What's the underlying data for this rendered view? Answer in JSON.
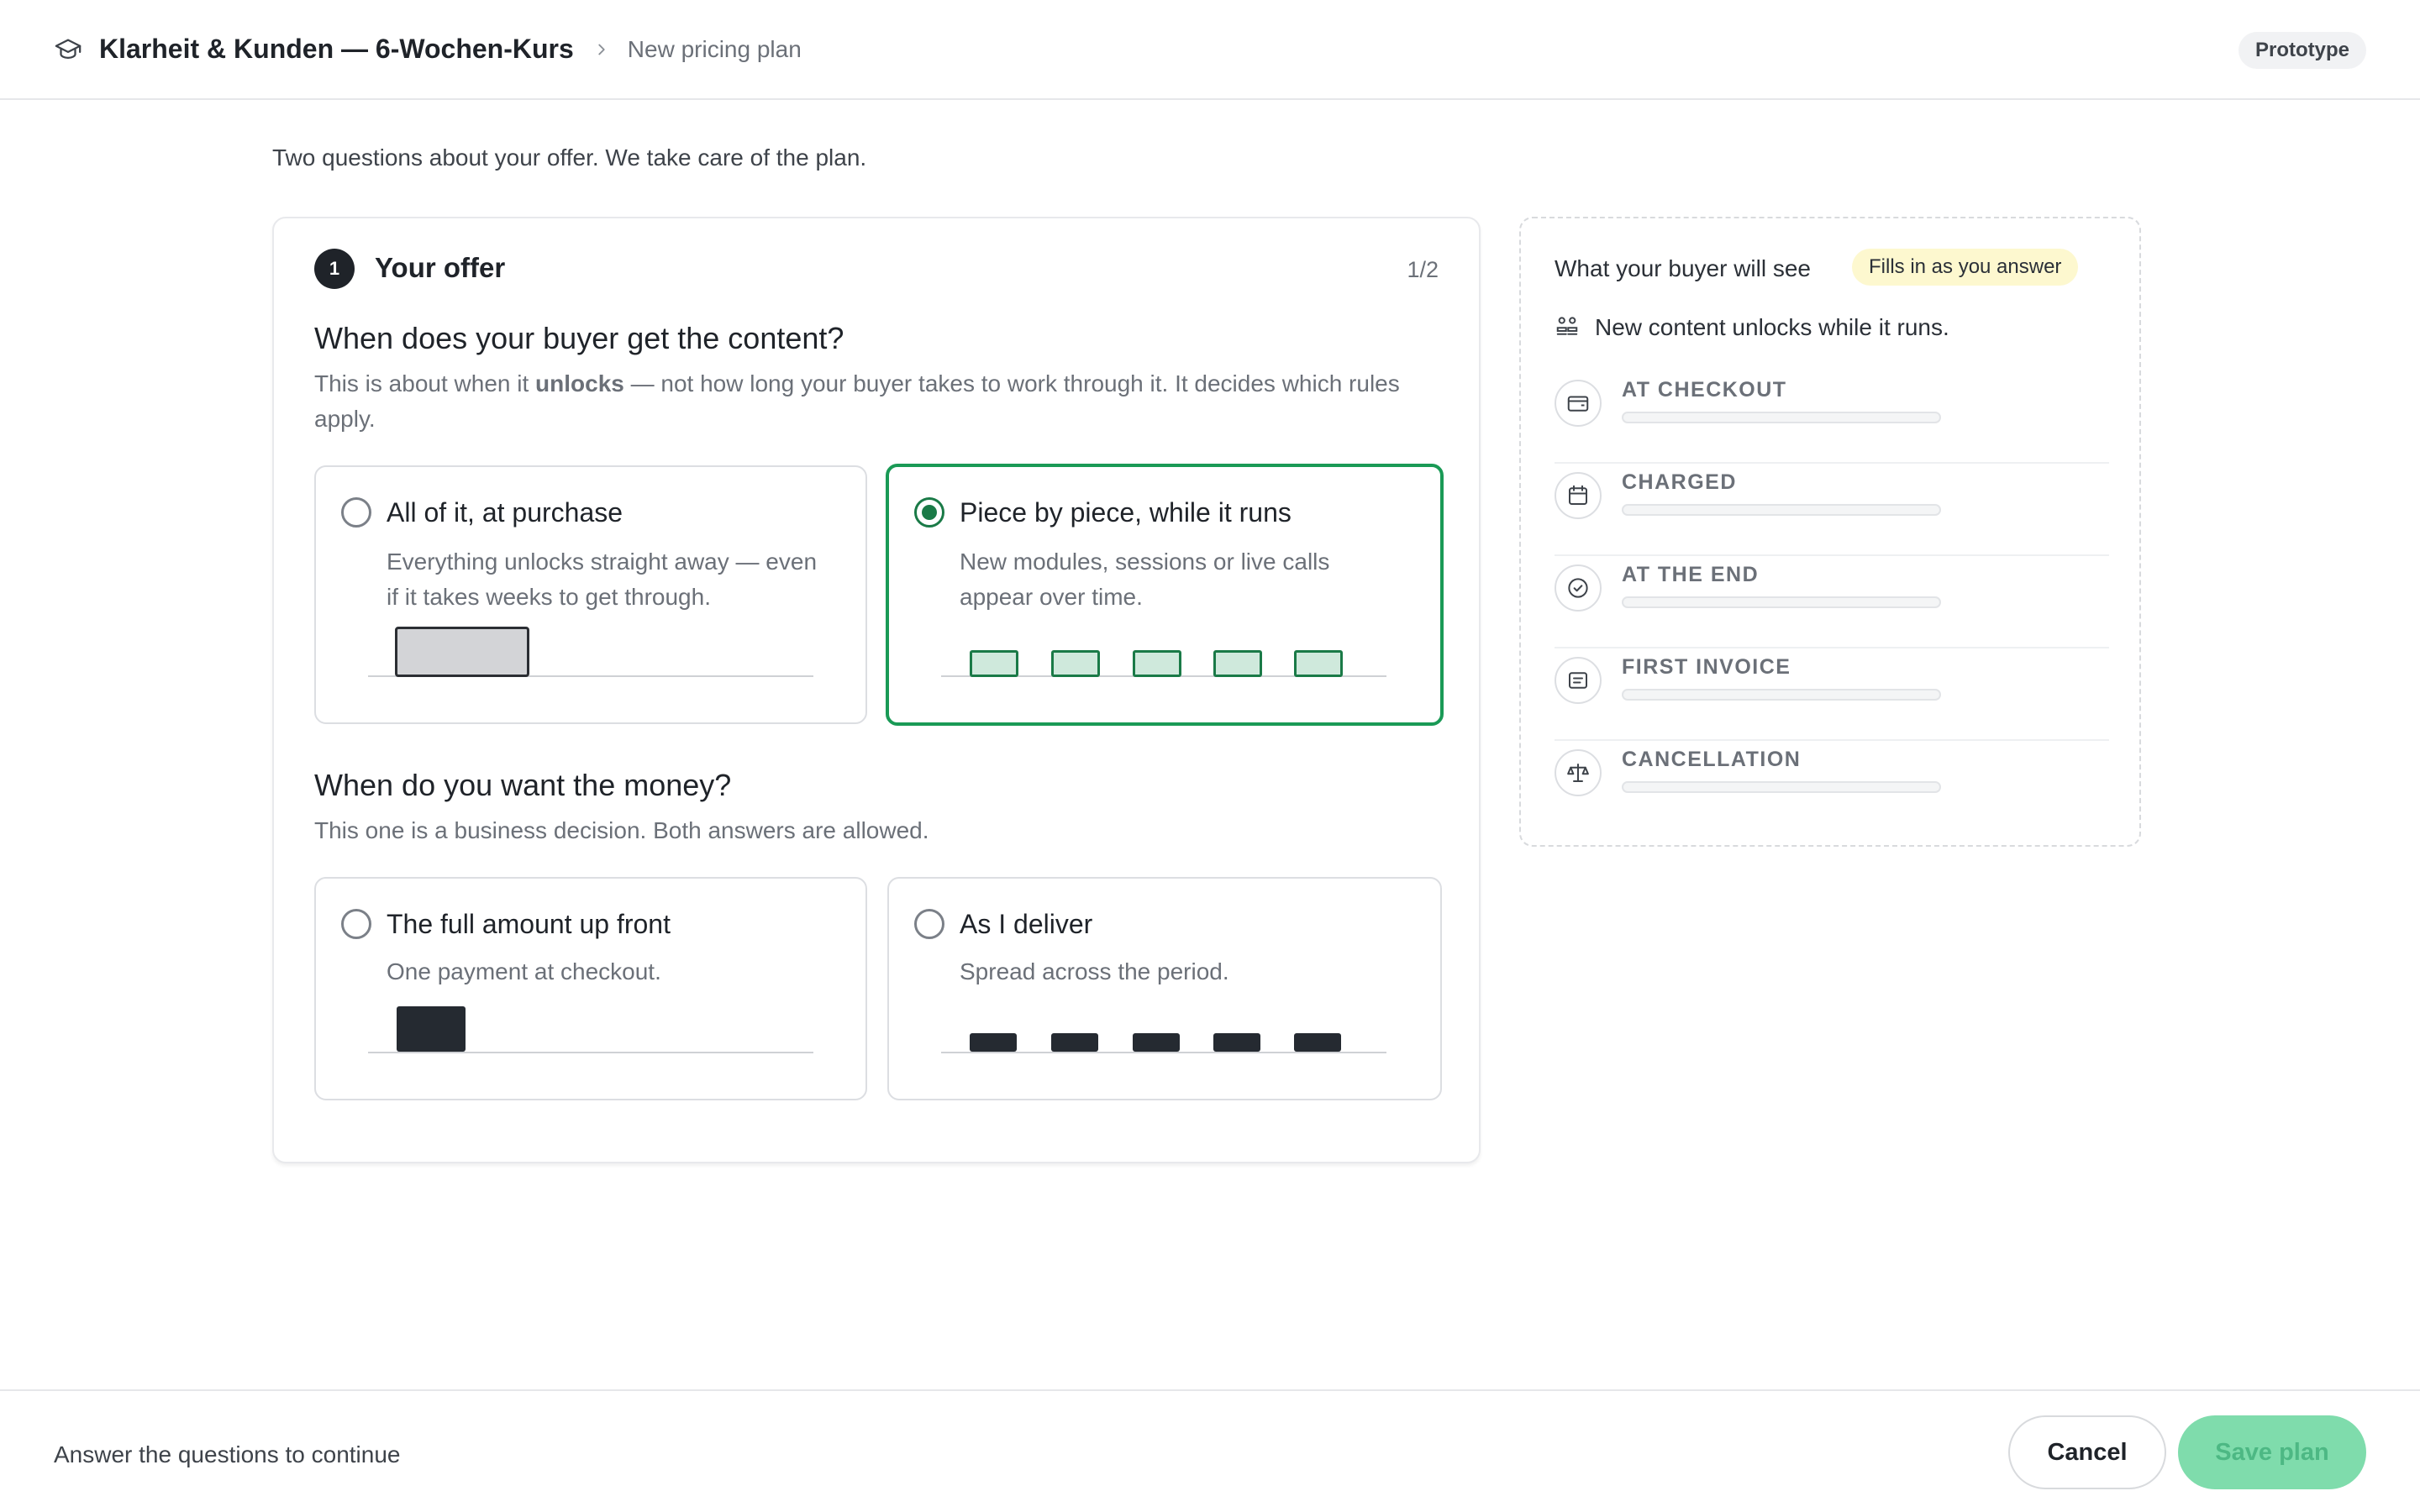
{
  "header": {
    "course_title": "Klarheit & Kunden — 6-Wochen-Kurs",
    "breadcrumb": "New pricing plan",
    "badge": "Prototype",
    "icons": [
      "graduation-cap-icon",
      "chevron-right-icon"
    ]
  },
  "intro": "Two questions about your offer. We take care of the plan.",
  "step": {
    "number": "1",
    "title": "Your offer",
    "count": "1/2"
  },
  "question1": {
    "title": "When does your buyer get the content?",
    "sub_before": "This is about when it ",
    "sub_bold": "unlocks",
    "sub_after": " — not how long your buyer takes to work through it. It decides which rules apply.",
    "options": [
      {
        "title": "All of it, at purchase",
        "desc": "Everything unlocks straight away — even if it takes weeks to get through.",
        "selected": false
      },
      {
        "title": "Piece by piece, while it runs",
        "desc": "New modules, sessions or live calls appear over time.",
        "selected": true
      }
    ]
  },
  "question2": {
    "title": "When do you want the money?",
    "sub": "This one is a business decision. Both answers are allowed.",
    "options": [
      {
        "title": "The full amount up front",
        "desc": "One payment at checkout.",
        "selected": false
      },
      {
        "title": "As I deliver",
        "desc": "Spread across the period.",
        "selected": false
      }
    ]
  },
  "preview": {
    "title": "What your buyer will see",
    "chip": "Fills in as you answer",
    "summary": "New content unlocks while it runs.",
    "rows": [
      {
        "label": "AT CHECKOUT",
        "icon": "wallet-icon"
      },
      {
        "label": "CHARGED",
        "icon": "calendar-icon"
      },
      {
        "label": "AT THE END",
        "icon": "check-circle-icon"
      },
      {
        "label": "FIRST INVOICE",
        "icon": "invoice-icon"
      },
      {
        "label": "CANCELLATION",
        "icon": "scale-icon"
      }
    ]
  },
  "footer": {
    "message": "Answer the questions to continue",
    "cancel_label": "Cancel",
    "save_label": "Save plan"
  },
  "colors": {
    "accent": "#1a9a56",
    "save_button_disabled": "#7fdcac",
    "chip_bg": "#fdf8cf"
  }
}
